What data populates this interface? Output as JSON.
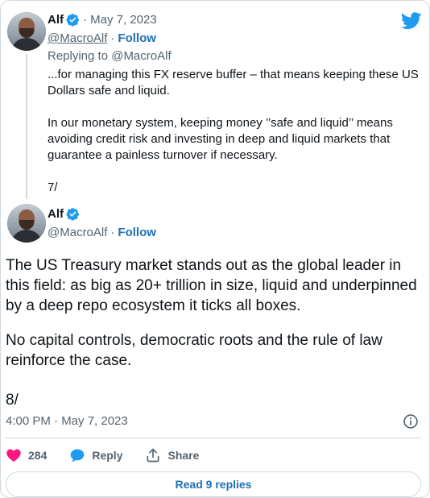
{
  "tweet1": {
    "author_name": "Alf",
    "date": "· May 7, 2023",
    "handle": "@MacroAlf",
    "separator": "·",
    "follow_label": "Follow",
    "replying_to": "Replying to @MacroAlf",
    "para1": "...for managing this FX reserve buffer – that means keeping these US Dollars safe and liquid.",
    "para2": "In our monetary system, keeping money ’’safe and liquid’’ means avoiding credit risk and investing in deep and liquid markets that guarantee a painless turnover if necessary.",
    "para3": "7/"
  },
  "tweet2": {
    "author_name": "Alf",
    "handle": "@MacroAlf",
    "separator": "·",
    "follow_label": "Follow",
    "para1": "The US Treasury market stands out as the global leader in this field: as big as 20+ trillion in size, liquid and underpinned by a deep repo ecosystem it ticks all boxes.",
    "para2": "No capital controls, democratic roots and the rule of law reinforce the case.",
    "para3": "8/",
    "timestamp": "4:00 PM · May 7, 2023"
  },
  "actions": {
    "like_count": "284",
    "reply_label": "Reply",
    "share_label": "Share"
  },
  "read_replies_label": "Read 9 replies",
  "colors": {
    "brand": "#1d9bf0",
    "link": "#1d70b8",
    "like": "#f91880",
    "muted": "#536471",
    "text": "#0f1419",
    "border": "#cfd9de"
  },
  "icons": {
    "logo": "twitter-bird-icon",
    "verified": "verified-badge-icon",
    "info": "info-icon",
    "like": "heart-icon",
    "reply": "speech-bubble-icon",
    "share": "share-upload-icon"
  }
}
